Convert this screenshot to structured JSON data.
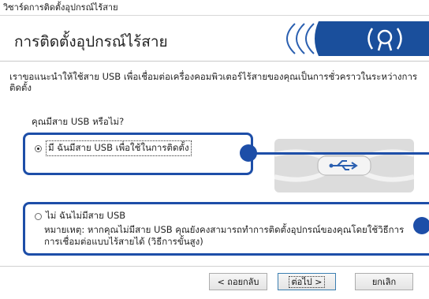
{
  "window": {
    "title": "วิซาร์ดการติดตั้งอุปกรณ์ไร้สาย"
  },
  "header": {
    "title": "การติดตั้งอุปกรณ์ไร้สาย",
    "banner_icon": "wifi-signal-icon"
  },
  "intro": {
    "text": "เราขอแนะนำให้ใช้สาย USB เพื่อเชื่อมต่อเครื่องคอมพิวเตอร์ไร้สายของคุณเป็นการชั่วคราวในระหว่างการติดตั้ง"
  },
  "question": {
    "text": "คุณมีสาย USB หรือไม่?"
  },
  "options": {
    "yes": {
      "label": "มี ฉันมีสาย USB เพื่อใช้ในการติดตั้ง",
      "selected": true
    },
    "no": {
      "label": "ไม่ ฉันไม่มีสาย USB",
      "selected": false,
      "note": "หมายเหตุ: หากคุณไม่มีสาย USB คุณยังคงสามารถทำการติดตั้งอุปกรณ์ของคุณโดยใช้วิธีการ การเชื่อมต่อแบบไร้สายได้ (วิธีการขั้นสูง)"
    }
  },
  "buttons": {
    "back": "< ถอยกลับ",
    "next": "ต่อไป >",
    "cancel": "ยกเลิก"
  },
  "colors": {
    "callout": "#1d4ea8",
    "banner_blue": "#1a4f9c"
  }
}
